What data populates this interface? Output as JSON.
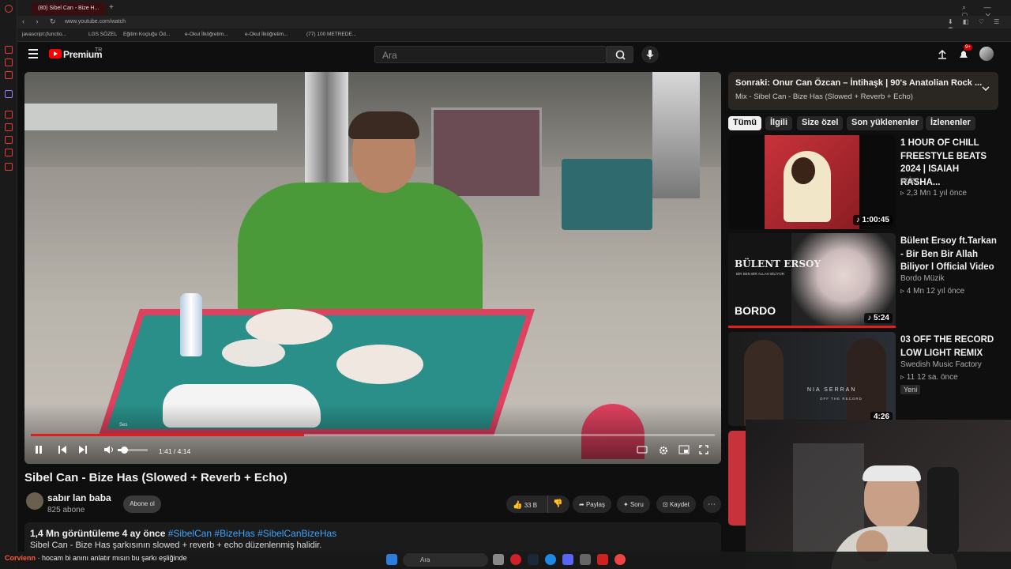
{
  "browser": {
    "tab_title": "(80) Sibel Can - Bize H...",
    "url": "www.youtube.com/watch",
    "bookmarks": [
      "javascript:(functio...",
      "LGS SÖZEL",
      "Eğitim Koçluğu Öd...",
      "e-Okul İlköğretim...",
      "e-Okul İlköğretim...",
      "(77) 100 METREDE..."
    ]
  },
  "header": {
    "logo": "Premium",
    "region": "TR",
    "search_placeholder": "Ara",
    "notifications": "9+"
  },
  "player": {
    "time": "1:41 / 4:14",
    "progress_fraction": 0.4,
    "volume_tooltip": "Ses"
  },
  "video": {
    "title": "Sibel Can - Bize Has (Slowed + Reverb + Echo)",
    "channel": "sabır lan baba",
    "subscribers": "825 abone",
    "subscribe_label": "Abone ol",
    "likes": "33 B",
    "share_label": "Paylaş",
    "ask_label": "Soru",
    "save_label": "Kaydet",
    "views_age": "1,4 Mn görüntüleme  4 ay önce",
    "tags": "#SibelCan #BizeHas #SibelCanBizeHas",
    "description": "Sibel Can - Bize Has şarkısının slowed + reverb + echo düzenlenmiş halidir."
  },
  "playlist": {
    "next": "Sonraki: Onur Can Özcan – İntihaşk | 90's Anatolian Rock ...",
    "mix": "Mix - Sibel Can - Bize Has (Slowed + Reverb + Echo)"
  },
  "chips": [
    "Tümü",
    "İlgili",
    "Size özel",
    "Son yüklenenler",
    "İzlenenler"
  ],
  "recommendations": [
    {
      "title": "1 HOUR OF CHILL FREESTYLE BEATS 2024 | ISAIAH RASHA...",
      "channel": "noizy",
      "meta": "▹ 2,3 Mn  1 yıl önce",
      "duration": "♪ 1:00:45",
      "badge": ""
    },
    {
      "title": "Bülent Ersoy ft.Tarkan - Bir Ben Bir Allah Biliyor l Official Video",
      "channel": "Bordo Müzik",
      "meta": "▹ 4 Mn  12 yıl önce",
      "duration": "♪ 5:24",
      "badge": ""
    },
    {
      "title": "03 OFF THE RECORD LOW LIGHT REMIX",
      "channel": "Swedish Music Factory",
      "meta": "▹ 11  12 sa. önce",
      "duration": "4:26",
      "badge": "Yeni"
    }
  ],
  "thumb_text": {
    "bulent": "BÜLENT ERSOY",
    "bulent_sub": "BİR BEN BİR ALLAH BİLİYOR",
    "bordo": "BORDO",
    "nia": "NIA SERRAN",
    "otr": "OFF THE RECORD"
  },
  "taskbar": {
    "chat_user": "Corvienn",
    "chat_text": " · hocam bi anını anlatır mısın bu şarkı eşliğinde",
    "search": "Ara"
  },
  "colors": {
    "accent": "#ff0000",
    "link": "#3ea6ff",
    "bg": "#0f0f0f"
  }
}
